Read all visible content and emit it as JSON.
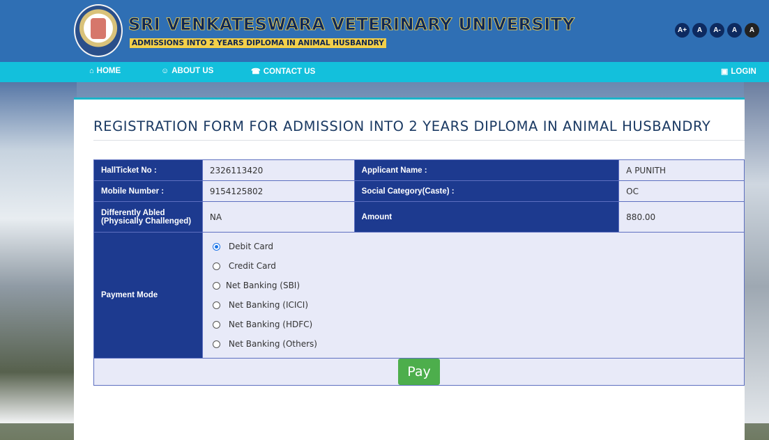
{
  "header": {
    "university_name": "SRI VENKATESWARA VETERINARY UNIVERSITY",
    "subtitle": "ADMISSIONS INTO 2 YEARS DIPLOMA IN ANIMAL HUSBANDRY",
    "font_controls": [
      "A+",
      "A",
      "A-",
      "A",
      "A"
    ]
  },
  "nav": {
    "home": "HOME",
    "about": "ABOUT US",
    "contact": "CONTACT US",
    "login": "LOGIN"
  },
  "form": {
    "title": "REGISTRATION FORM FOR ADMISSION INTO 2 YEARS DIPLOMA IN ANIMAL HUSBANDRY",
    "rows": [
      {
        "label1": "HallTicket No :",
        "value1": "2326113420",
        "label2": "Applicant Name :",
        "value2": "A PUNITH"
      },
      {
        "label1": "Mobile Number :",
        "value1": "9154125802",
        "label2": "Social Category(Caste) :",
        "value2": "OC"
      },
      {
        "label1": "Differently Abled (Physically Challenged)",
        "value1": "NA",
        "label2": "Amount",
        "value2": "880.00"
      }
    ],
    "payment_mode_label": "Payment Mode",
    "payment_options": [
      "Debit Card",
      "Credit Card",
      "Net Banking (SBI)",
      "Net Banking (ICICI)",
      "Net Banking (HDFC)",
      "Net Banking (Others)"
    ],
    "selected_option": "Debit Card",
    "pay_button": "Pay"
  },
  "colors": {
    "header_bg": "#2f6fb4",
    "nav_bg": "#13c0dc",
    "label_bg": "#1d3a8f",
    "value_bg": "#e8eaf8",
    "pay_button": "#4dae4c"
  }
}
